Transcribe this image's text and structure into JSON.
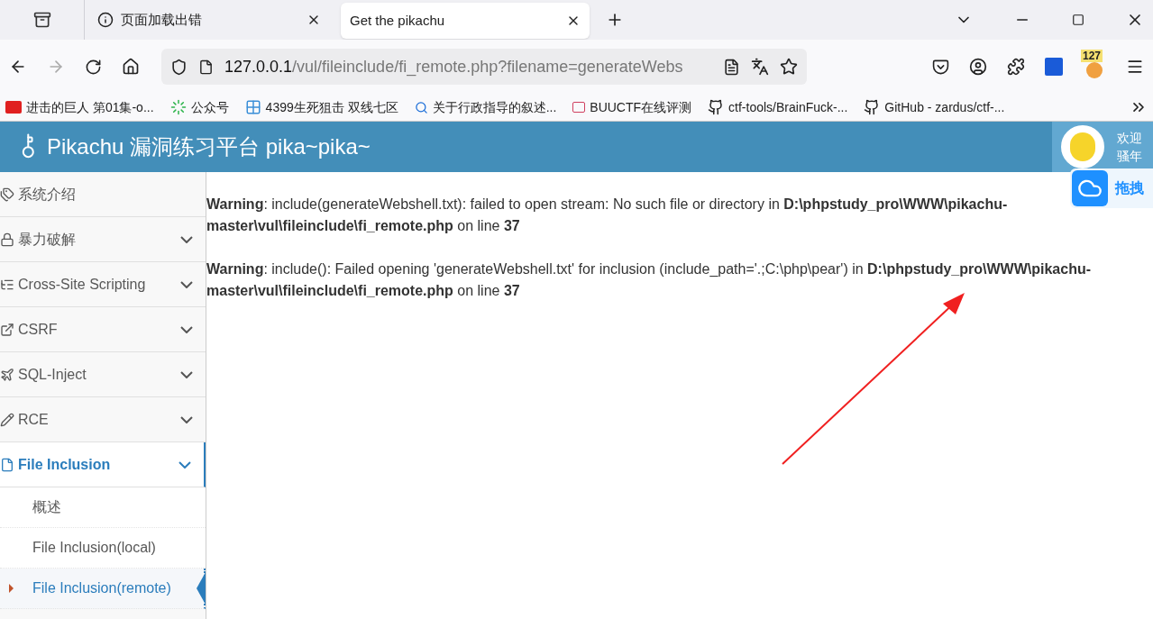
{
  "browser": {
    "tabs": [
      {
        "title": "页面加载出错",
        "selected": false,
        "kind": "error"
      },
      {
        "title": "Get the pikachu",
        "selected": true,
        "kind": "page"
      }
    ],
    "url": {
      "host": "127.0.0.1",
      "path": "/vul/fileinclude/fi_remote.php?filename=generateWebs"
    },
    "extension_badge": "127",
    "bookmarks": [
      {
        "title": "进击的巨人 第01集-o...",
        "kind": "video"
      },
      {
        "title": "公众号",
        "kind": "green"
      },
      {
        "title": "4399生死狙击 双线七区",
        "kind": "grid"
      },
      {
        "title": "关于行政指导的叙述...",
        "kind": "search"
      },
      {
        "title": "BUUCTF在线评测",
        "kind": "buu"
      },
      {
        "title": "ctf-tools/BrainFuck-...",
        "kind": "github"
      },
      {
        "title": "GitHub - zardus/ctf-...",
        "kind": "github"
      }
    ]
  },
  "header": {
    "title": "Pikachu 漏洞练习平台 pika~pika~",
    "welcome": "欢迎",
    "user": "骚年"
  },
  "floating_widget": {
    "label": "拖拽"
  },
  "sidebar": {
    "items": [
      {
        "label": "系统介绍",
        "kind": "link",
        "selected": false
      },
      {
        "label": "暴力破解",
        "kind": "group",
        "expanded": false,
        "selected": false
      },
      {
        "label": "Cross-Site Scripting",
        "kind": "group",
        "expanded": false,
        "selected": false
      },
      {
        "label": "CSRF",
        "kind": "group",
        "expanded": false,
        "selected": false
      },
      {
        "label": "SQL-Inject",
        "kind": "group",
        "expanded": false,
        "selected": false
      },
      {
        "label": "RCE",
        "kind": "group",
        "expanded": false,
        "selected": false
      },
      {
        "label": "File Inclusion",
        "kind": "group",
        "expanded": true,
        "selected": true,
        "children": [
          {
            "label": "概述",
            "selected": false
          },
          {
            "label": "File Inclusion(local)",
            "selected": false
          },
          {
            "label": "File Inclusion(remote)",
            "selected": true
          }
        ]
      }
    ]
  },
  "warnings": [
    "**Warning**: include(generateWebshell.txt): failed to open stream: No such file or directory in **D:\\phpstudy_pro\\WWW\\pikachu-master\\vul\\fileinclude\\fi_remote.php** on line **37**",
    "**Warning**: include(): Failed opening 'generateWebshell.txt' for inclusion (include_path='.;C:\\php\\pear') in **D:\\phpstudy_pro\\WWW\\pikachu-master\\vul\\fileinclude\\fi_remote.php** on line **37**"
  ]
}
